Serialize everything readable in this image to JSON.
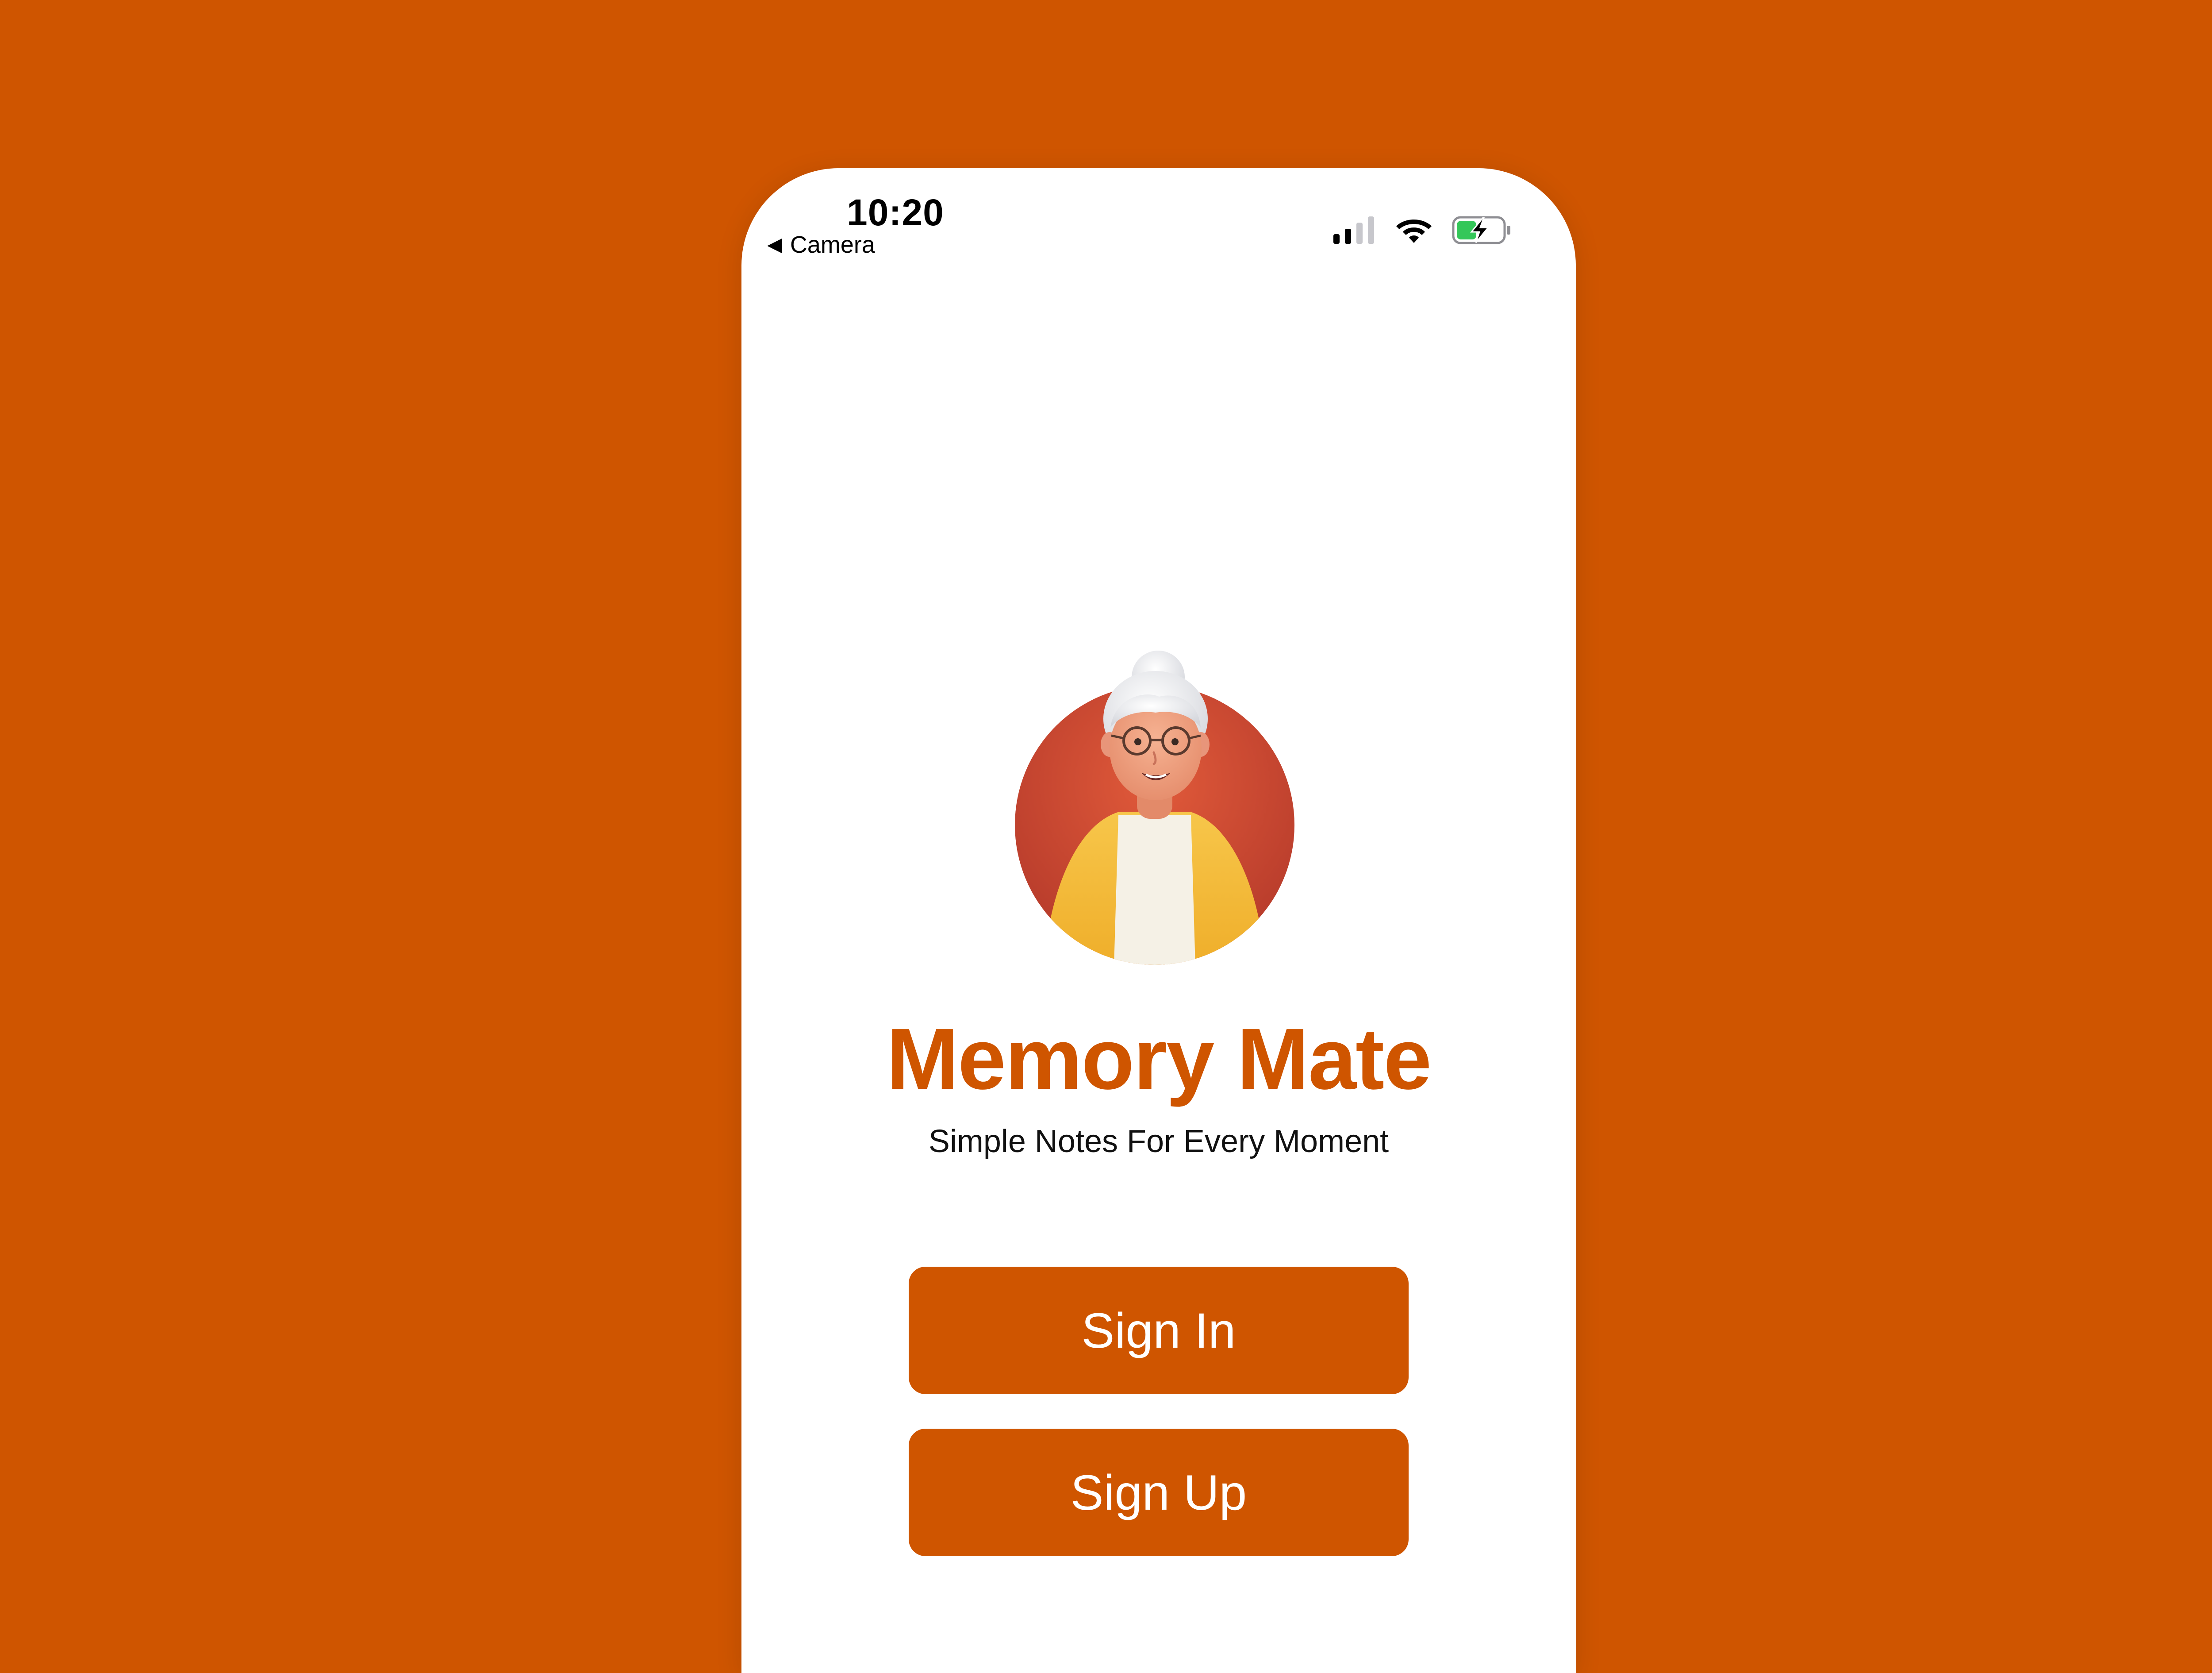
{
  "status_bar": {
    "time": "10:20",
    "back_label": "Camera",
    "icons": [
      "signal-icon",
      "wifi-icon",
      "battery-charging-icon"
    ]
  },
  "app": {
    "title": "Memory Mate",
    "tagline": "Simple Notes For Every Moment",
    "avatar": "elderly-woman-avatar"
  },
  "actions": {
    "sign_in_label": "Sign In",
    "sign_up_label": "Sign Up"
  },
  "colors": {
    "brand": "#CF5500",
    "background": "#CF5500",
    "screen": "#FFFFFF",
    "battery_charge": "#34C759"
  }
}
